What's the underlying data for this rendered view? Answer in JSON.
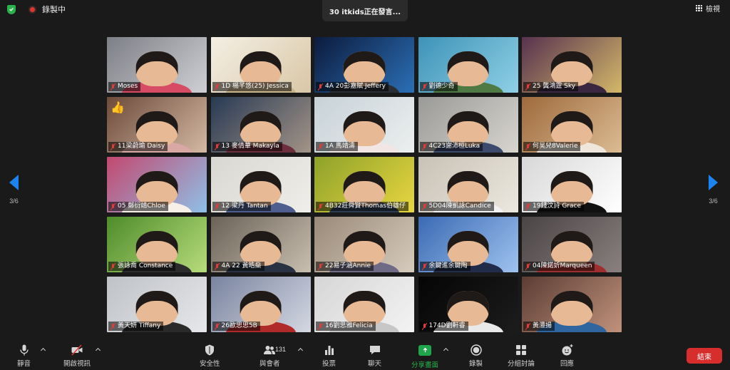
{
  "topbar": {
    "recording_label": "錄製中",
    "speaker_text": "30 itkids正在發言...",
    "view_label": "檢視"
  },
  "nav": {
    "page_indicator": "3/6"
  },
  "tiles": [
    {
      "name": "Moses",
      "bg": "#7d7f86",
      "bg2": "#cfd0d4",
      "shirt": "#d84b64"
    },
    {
      "name": "1D 楊芊悠(25) Jessica",
      "bg": "#f4efe4",
      "bg2": "#d9c7a6",
      "shirt": "#c9b48b"
    },
    {
      "name": "4A 20彭嘉賦 Jeffery",
      "bg": "#0c1b3d",
      "bg2": "#2b6fb6",
      "shirt": "#2a2d33"
    },
    {
      "name": "劉德少奇",
      "bg": "#3e93b8",
      "bg2": "#8fd0e6",
      "shirt": "#4f7a44"
    },
    {
      "name": "25 龔鴻霆 Sky",
      "bg": "#57324f",
      "bg2": "#d4b86a",
      "shirt": "#3b2840"
    },
    {
      "name": "11梁蔚瑜  Daisy",
      "bg": "#6d4a3a",
      "bg2": "#d4b9a4",
      "shirt": "#d9a8a5",
      "thumb": true
    },
    {
      "name": "13 麥倩華 Makayla",
      "bg": "#283a54",
      "bg2": "#a39487",
      "shirt": "#6d2f3d"
    },
    {
      "name": "1A 馬靖濤",
      "bg": "#c7d2d8",
      "bg2": "#ecefef",
      "shirt": "#f1e6e4"
    },
    {
      "name": "4C23謝沛桓Luka",
      "bg": "#9a9a98",
      "bg2": "#d8d5cf",
      "shirt": "#3c4b6b"
    },
    {
      "name": "何昊兒8Valerie",
      "bg": "#9e6a3d",
      "bg2": "#dcbc93",
      "shirt": "#efe7dc"
    },
    {
      "name": "05  鄭衍靖Chloe",
      "bg": "#c3486f",
      "bg2": "#8fc0e8",
      "shirt": "#f6f0e8"
    },
    {
      "name": "12 梁丹 Tantan",
      "bg": "#d9d7d2",
      "bg2": "#efeeea",
      "shirt": "#4e5f8f"
    },
    {
      "name": "4B32莊舜賢Thomas伯雄仔",
      "bg": "#8ea22a",
      "bg2": "#e8d640",
      "shirt": "#2e3c52"
    },
    {
      "name": "5D04陳凱詠Candice",
      "bg": "#c8c2b6",
      "bg2": "#ece8df",
      "shirt": "#f2f2f2"
    },
    {
      "name": "19錢汶詩 Grace",
      "bg": "#d8d8d8",
      "bg2": "#ffffff",
      "shirt": "#111111"
    },
    {
      "name": "張詠喬 Constance",
      "bg": "#4f8c2a",
      "bg2": "#b7dc7c",
      "shirt": "#2c2c2c"
    },
    {
      "name": "4A 22 黃皓燊",
      "bg": "#6b6258",
      "bg2": "#c9bfb0",
      "shirt": "#283242"
    },
    {
      "name": "22易子涵Annie",
      "bg": "#9a8a78",
      "bg2": "#d6cbbd",
      "shirt": "#6f6a86"
    },
    {
      "name": "余鍵進余鍵陶",
      "bg": "#3b6ab4",
      "bg2": "#9fc3ef",
      "shirt": "#202c4a"
    },
    {
      "name": "04陳鍩妡Marqueen",
      "bg": "#4a4444",
      "bg2": "#8a8080",
      "shirt": "#9f2f2f"
    },
    {
      "name": "黃天妍 Tiffany",
      "bg": "#bfc2c7",
      "bg2": "#e6e7ea",
      "shirt": "#2a2a2a"
    },
    {
      "name": "26歐思思5B",
      "bg": "#7a84a0",
      "bg2": "#d4d8e2",
      "shirt": "#b12a2a"
    },
    {
      "name": "16劉思雅Felicia",
      "bg": "#d6d6d6",
      "bg2": "#f3f3f3",
      "shirt": "#c7c7c7"
    },
    {
      "name": "174D劉軒睿",
      "bg": "#050505",
      "bg2": "#1c1c1c",
      "shirt": "#e9e9e9"
    },
    {
      "name": "黃灃揚",
      "bg": "#5c3d34",
      "bg2": "#c0927c",
      "shirt": "#2f66a0"
    }
  ],
  "toolbar": {
    "mute_label": "靜音",
    "video_label": "開啟視訊",
    "security_label": "安全性",
    "participants_label": "與會者",
    "participants_count": "131",
    "polls_label": "投票",
    "chat_label": "聊天",
    "share_label": "分享畫面",
    "record_label": "錄製",
    "breakout_label": "分組討論",
    "reactions_label": "回應",
    "end_label": "結束"
  },
  "colors": {
    "accent_blue": "#1b84f0",
    "share_green": "#1fa54a",
    "end_red": "#d72d2d",
    "security_green": "#2bb24c"
  }
}
